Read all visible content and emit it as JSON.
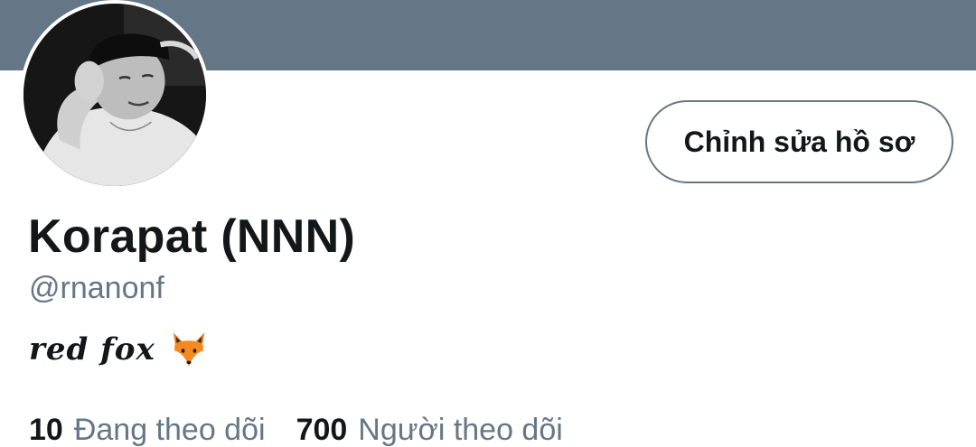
{
  "profile": {
    "display_name": "Korapat (NNN)",
    "handle": "@rnanonf",
    "bio_text": "red fox",
    "bio_emoji_icon": "fox-face-icon",
    "edit_button_label": "Chỉnh sửa hồ sơ"
  },
  "stats": {
    "following_count": "10",
    "following_label": "Đang theo dõi",
    "followers_count": "700",
    "followers_label": "Người theo dõi"
  },
  "colors": {
    "banner": "#657786",
    "text_primary": "#14171a",
    "text_secondary": "#657786",
    "button_border": "#657786"
  }
}
